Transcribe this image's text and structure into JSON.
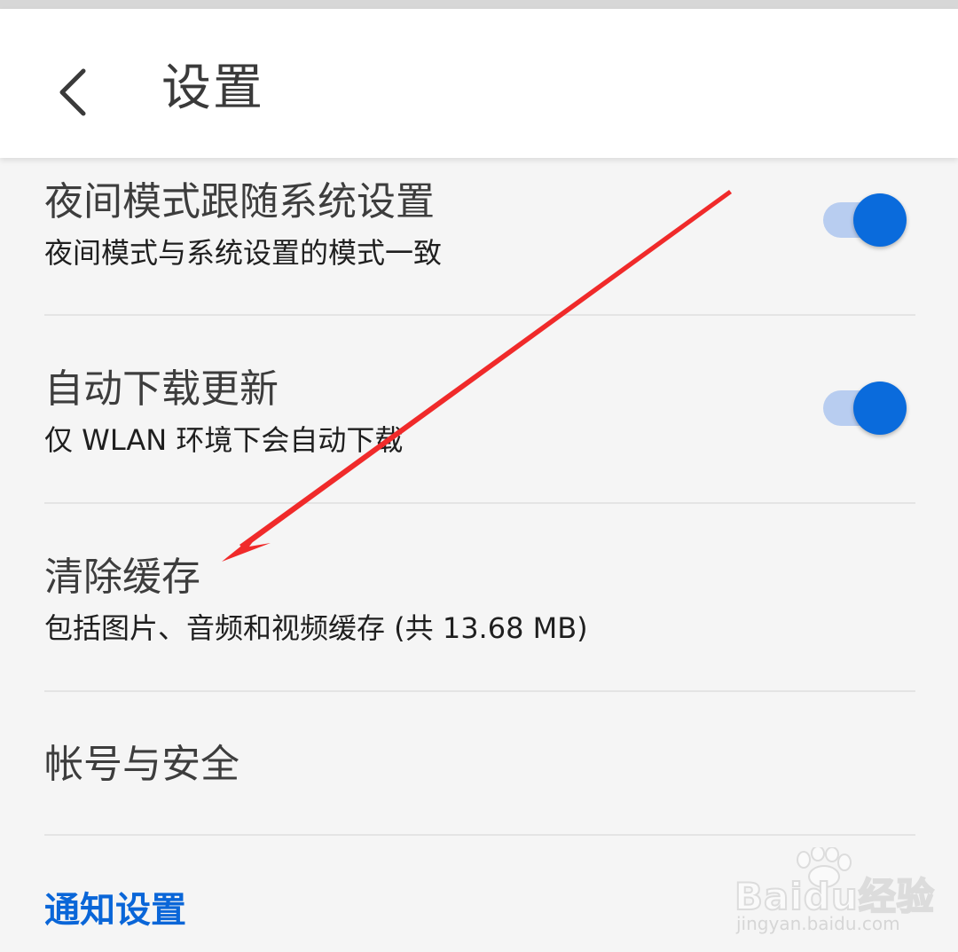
{
  "header": {
    "title": "设置",
    "back_icon": "chevron-left-icon"
  },
  "settings": [
    {
      "title": "夜间模式跟随系统设置",
      "subtitle": "夜间模式与系统设置的模式一致",
      "toggle": {
        "on": true
      }
    },
    {
      "title": "自动下载更新",
      "subtitle": "仅 WLAN 环境下会自动下载",
      "toggle": {
        "on": true
      }
    },
    {
      "title": "清除缓存",
      "subtitle": "包括图片、音频和视频缓存 (共 13.68 MB)"
    },
    {
      "title": "帐号与安全"
    }
  ],
  "section": {
    "label": "通知设置"
  },
  "watermark": {
    "brand": "Baidu经验",
    "url": "jingyan.baidu.com"
  },
  "colors": {
    "accent": "#0a6bdc",
    "toggle_track": "#b8cdf0",
    "section_label": "#0a66d8",
    "annotation_arrow": "#f02a2a",
    "background": "#f5f5f5",
    "header_background": "#ffffff"
  }
}
